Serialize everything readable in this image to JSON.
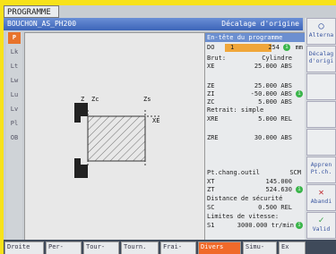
{
  "title": "PROGRAMME",
  "file_name": "BOUCHON_AS_PH200",
  "header_right": "Décalage d'origine",
  "panel": {
    "header": "En-tête du programme",
    "rows": [
      {
        "lab": "DO",
        "val": "254",
        "unit": "mm"
      },
      {
        "lab": "Brut:",
        "val": "Cylindre",
        "unit": ""
      },
      {
        "lab": "XE",
        "val": "25.000 ABS",
        "unit": ""
      },
      {
        "lab": "ZE",
        "val": "25.000 ABS",
        "unit": ""
      },
      {
        "lab": "ZI",
        "val": "-50.000 ABS",
        "unit": ""
      },
      {
        "lab": "ZC",
        "val": "5.000 ABS",
        "unit": ""
      },
      {
        "lab": "Retrait: simple",
        "val": "",
        "unit": ""
      },
      {
        "lab": "XRE",
        "val": "5.000 REL",
        "unit": ""
      },
      {
        "lab": "ZRE",
        "val": "30.000 ABS",
        "unit": ""
      },
      {
        "lab": "Pt.chang.outil",
        "val": "SCM",
        "unit": ""
      },
      {
        "lab": "XT",
        "val": "145.000",
        "unit": ""
      },
      {
        "lab": "ZT",
        "val": "524.630",
        "unit": ""
      },
      {
        "lab": "Distance de sécurité",
        "val": "",
        "unit": ""
      },
      {
        "lab": "SC",
        "val": "0.500 REL",
        "unit": ""
      },
      {
        "lab": "Limites de vitesse:",
        "val": "",
        "unit": ""
      },
      {
        "lab": "S1",
        "val": "3000.000 tr/min",
        "unit": ""
      }
    ],
    "do_value_field": "1"
  },
  "left_tools": [
    "P",
    "Lk",
    "Lt",
    "Lw",
    "Lu",
    "Lv",
    "Pl",
    "OB"
  ],
  "canvas_labels": {
    "z1": "Z",
    "zc": "Zc",
    "zs": "Zs",
    "x": "XE"
  },
  "right_buttons": [
    {
      "icon": "◯",
      "label": "Alterna"
    },
    {
      "icon": "",
      "label": "Décalag d'origi"
    },
    {
      "icon": "",
      "label": ""
    },
    {
      "icon": "",
      "label": ""
    },
    {
      "icon": "",
      "label": ""
    },
    {
      "icon": "",
      "label": "Appren Pt.ch."
    },
    {
      "icon": "✕",
      "label": "Abandi"
    },
    {
      "icon": "✓",
      "label": "Valid"
    }
  ],
  "bottom_buttons": [
    {
      "label": "Droite"
    },
    {
      "label": "Per-"
    },
    {
      "label": "Tour-"
    },
    {
      "label": "Tourn."
    },
    {
      "label": "Frai-"
    },
    {
      "label": "Divers"
    },
    {
      "label": "Simu-"
    },
    {
      "label": "Ex"
    }
  ]
}
